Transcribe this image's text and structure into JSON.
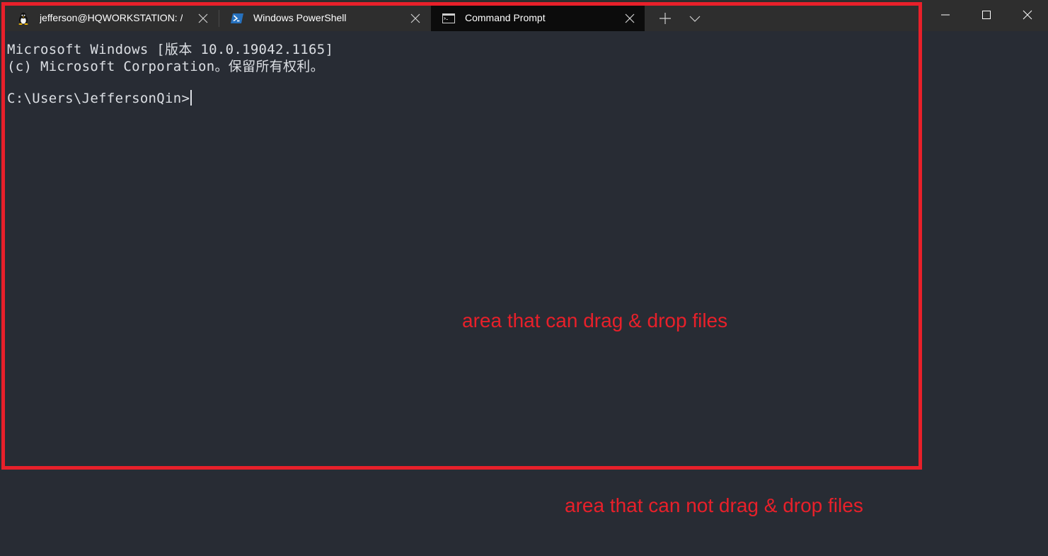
{
  "tabs": [
    {
      "label": "jefferson@HQWORKSTATION: /",
      "icon": "linux-penguin-icon",
      "active": false
    },
    {
      "label": "Windows PowerShell",
      "icon": "powershell-icon",
      "active": false
    },
    {
      "label": "Command Prompt",
      "icon": "command-prompt-icon",
      "active": true
    }
  ],
  "terminal": {
    "lines": [
      "Microsoft Windows [版本 10.0.19042.1165]",
      "(c) Microsoft Corporation。保留所有权利。",
      "",
      "C:\\Users\\JeffersonQin>"
    ]
  },
  "annotations": {
    "inside": "area that can drag & drop files",
    "outside": "area that can not drag & drop files"
  },
  "colors": {
    "highlight": "#e8202a",
    "terminal_bg": "#282c34",
    "titlebar_bg": "#2e2e2e",
    "active_tab_bg": "#0c0c0c"
  }
}
